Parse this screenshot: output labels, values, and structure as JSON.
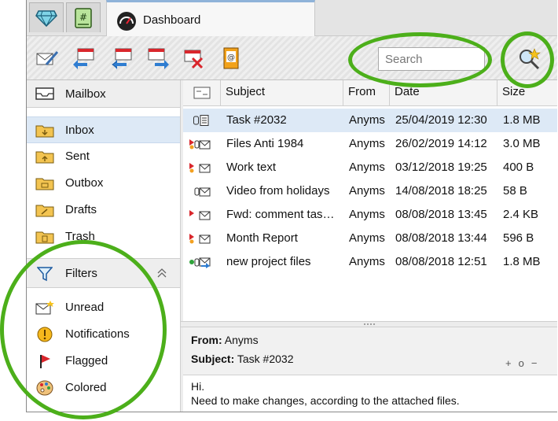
{
  "tabs": {
    "dashboard_label": "Dashboard"
  },
  "toolbar": {
    "search_placeholder": "Search",
    "icons": [
      "compose-icon",
      "reply-icon",
      "reply-all-icon",
      "forward-icon",
      "delete-icon",
      "address-book-icon"
    ]
  },
  "sidebar": {
    "mailbox_label": "Mailbox",
    "folders": [
      {
        "label": "Inbox",
        "icon": "inbox-folder-icon"
      },
      {
        "label": "Sent",
        "icon": "sent-folder-icon"
      },
      {
        "label": "Outbox",
        "icon": "outbox-folder-icon"
      },
      {
        "label": "Drafts",
        "icon": "drafts-folder-icon"
      },
      {
        "label": "Trash",
        "icon": "trash-folder-icon"
      }
    ],
    "filters_label": "Filters",
    "filters": [
      {
        "label": "Unread",
        "icon": "unread-icon"
      },
      {
        "label": "Notifications",
        "icon": "notification-icon"
      },
      {
        "label": "Flagged",
        "icon": "flag-icon"
      },
      {
        "label": "Colored",
        "icon": "palette-icon"
      }
    ]
  },
  "list": {
    "columns": {
      "subject": "Subject",
      "from": "From",
      "date": "Date",
      "size": "Size"
    },
    "rows": [
      {
        "subject": "Task #2032",
        "from": "Anyms",
        "date": "25/04/2019 12:30",
        "size": "1.8 MB"
      },
      {
        "subject": "Files Anti 1984",
        "from": "Anyms",
        "date": "26/02/2019 14:12",
        "size": "3.0 MB"
      },
      {
        "subject": "Work text",
        "from": "Anyms",
        "date": "03/12/2018 19:25",
        "size": "400 B"
      },
      {
        "subject": "Video from holidays",
        "from": "Anyms",
        "date": "14/08/2018 18:25",
        "size": "58 B"
      },
      {
        "subject": "Fwd: comment tas…",
        "from": "Anyms",
        "date": "08/08/2018 13:45",
        "size": "2.4 KB"
      },
      {
        "subject": "Month Report",
        "from": "Anyms",
        "date": "08/08/2018 13:44",
        "size": "596 B"
      },
      {
        "subject": "new project files",
        "from": "Anyms",
        "date": "08/08/2018 12:51",
        "size": "1.8 MB"
      }
    ]
  },
  "preview": {
    "from_label": "From:",
    "from_value": "Anyms",
    "subject_label": "Subject:",
    "subject_value": "Task #2032",
    "controls": [
      "+",
      "o",
      "−"
    ],
    "body_line1": "Hi.",
    "body_line2": "Need to make changes, according to the attached files."
  },
  "colors": {
    "accent_green": "#4caf1a",
    "selection": "#dde9f6",
    "flag_red": "#d9262c"
  }
}
